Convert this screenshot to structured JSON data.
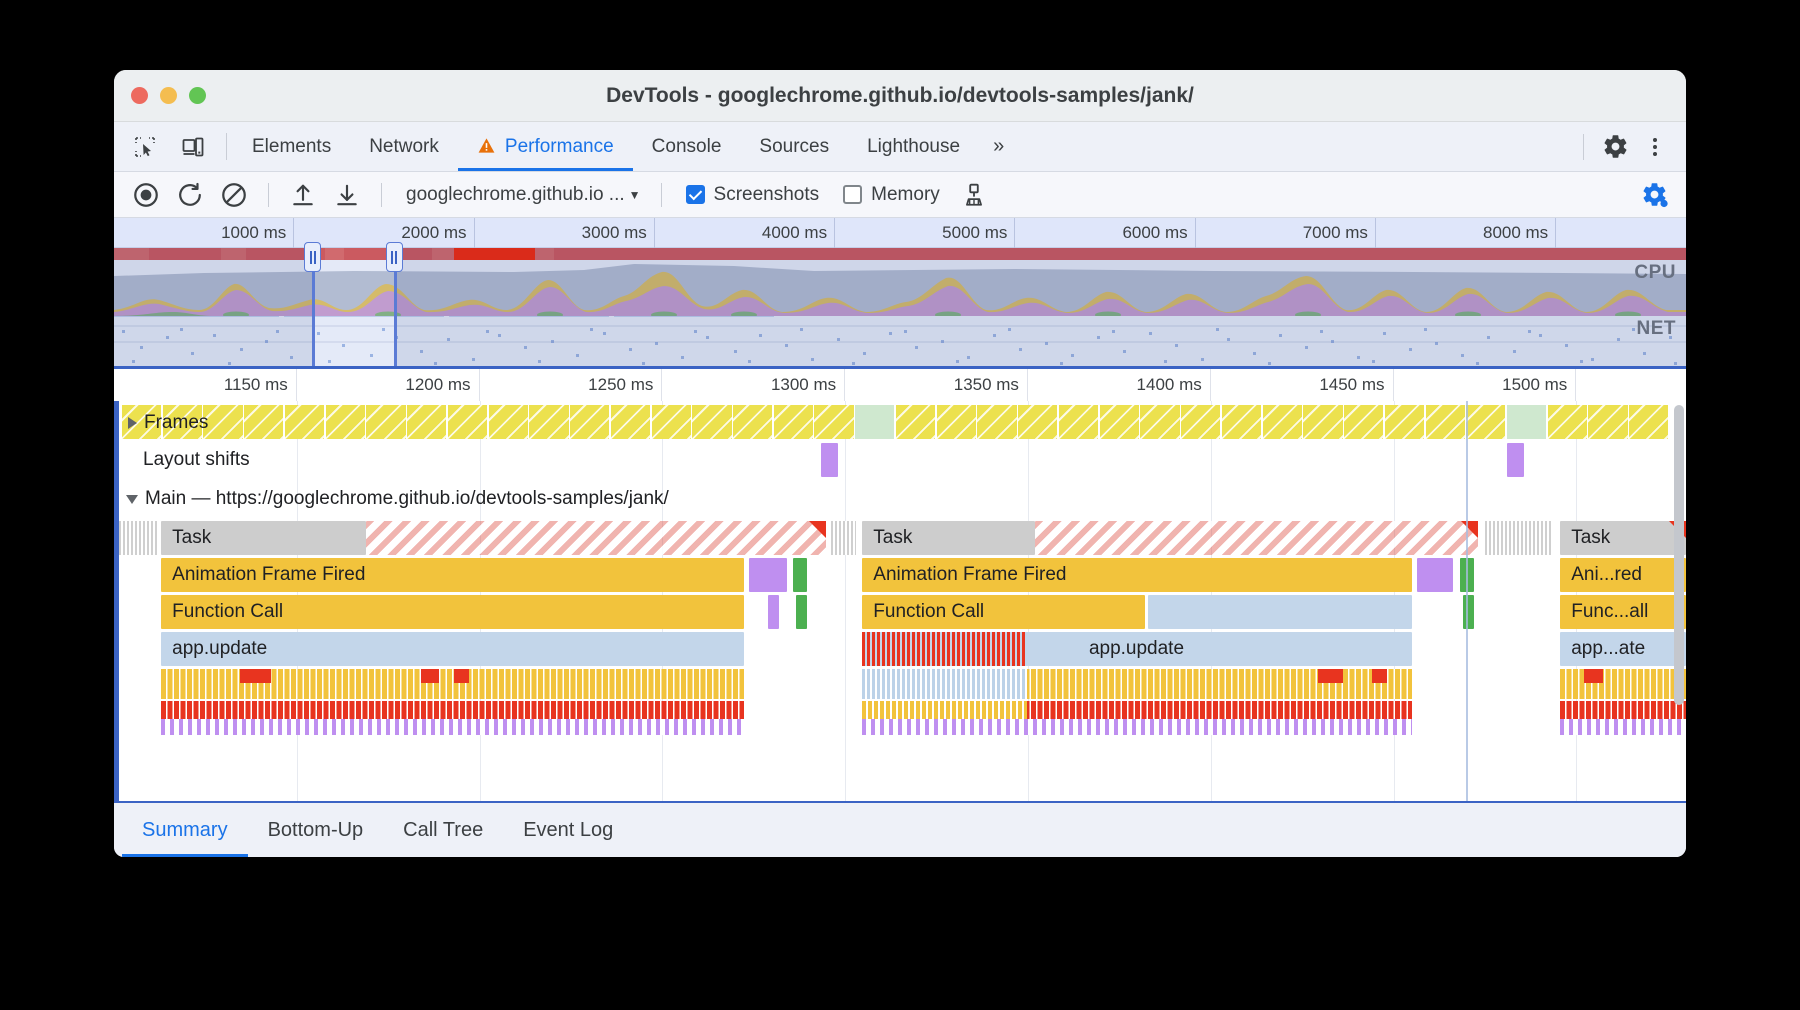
{
  "window": {
    "title": "DevTools - googlechrome.github.io/devtools-samples/jank/",
    "traffic": {
      "close": "close-button",
      "minimize": "minimize-button",
      "zoom": "zoom-button"
    }
  },
  "tabstrip": {
    "inspect_icon": "inspect-element-icon",
    "device_icon": "device-toolbar-icon",
    "tabs": [
      {
        "label": "Elements",
        "active": false,
        "warn": false
      },
      {
        "label": "Network",
        "active": false,
        "warn": false
      },
      {
        "label": "Performance",
        "active": true,
        "warn": true
      },
      {
        "label": "Console",
        "active": false,
        "warn": false
      },
      {
        "label": "Sources",
        "active": false,
        "warn": false
      },
      {
        "label": "Lighthouse",
        "active": false,
        "warn": false
      }
    ],
    "more_tabs": "»",
    "settings_icon": "gear-icon",
    "menu_icon": "kebab-menu-icon"
  },
  "controls": {
    "record": "record-button",
    "reload": "reload-and-record-button",
    "clear": "clear-recording-button",
    "load": "load-profile-button",
    "save": "save-profile-button",
    "target_label": "googlechrome.github.io ...",
    "target_caret": "▼",
    "screenshots_label": "Screenshots",
    "screenshots_checked": true,
    "memory_label": "Memory",
    "memory_checked": false,
    "gc_icon": "collect-garbage-icon",
    "capture_settings_icon": "capture-settings-gear-icon"
  },
  "overview": {
    "ticks": [
      "1000 ms",
      "2000 ms",
      "3000 ms",
      "4000 ms",
      "5000 ms",
      "6000 ms",
      "7000 ms",
      "8000 ms"
    ],
    "cpu_label": "CPU",
    "net_label": "NET",
    "selection_start_pct": 12.6,
    "selection_end_pct": 17.8,
    "handle_left_icon": "window-handle-left",
    "handle_right_icon": "window-handle-right"
  },
  "flame": {
    "ticks": [
      "1150 ms",
      "1200 ms",
      "1250 ms",
      "1300 ms",
      "1350 ms",
      "1400 ms",
      "1450 ms",
      "1500 ms"
    ],
    "tracks": {
      "frames": {
        "label": "Frames",
        "expander": "collapsed"
      },
      "layout_shifts": {
        "label": "Layout shifts"
      },
      "main": {
        "label": "Main — https://googlechrome.github.io/devtools-samples/jank/",
        "expander": "expanded"
      }
    },
    "groups": [
      {
        "name": "group-1",
        "left_pct": 2.0,
        "width_pct": 45.5,
        "task_label": "Task",
        "rows": [
          {
            "label": "Animation Frame Fired",
            "kind": "yellow"
          },
          {
            "label": "Function Call",
            "kind": "yellow"
          },
          {
            "label": "app.update",
            "kind": "blue"
          }
        ]
      },
      {
        "name": "group-2",
        "left_pct": 47.6,
        "width_pct": 39.5,
        "task_label": "Task",
        "rows": [
          {
            "label": "Animation Frame Fired",
            "kind": "yellow"
          },
          {
            "label": "Function Call",
            "kind": "yellow"
          },
          {
            "label": "app.update",
            "kind": "blue"
          }
        ]
      },
      {
        "name": "group-3",
        "left_pct": 92.0,
        "width_pct": 8.0,
        "task_label": "Task",
        "rows": [
          {
            "label": "Ani...red",
            "kind": "yellow"
          },
          {
            "label": "Func...all",
            "kind": "yellow"
          },
          {
            "label": "app...ate",
            "kind": "blue"
          }
        ]
      }
    ]
  },
  "bottom_tabs": [
    {
      "label": "Summary",
      "active": true
    },
    {
      "label": "Bottom-Up",
      "active": false
    },
    {
      "label": "Call Tree",
      "active": false
    },
    {
      "label": "Event Log",
      "active": false
    }
  ],
  "colors": {
    "accent": "#1a73e8",
    "warning": "#e8710a",
    "frame_yellow": "#ece14e",
    "task_gray": "#cdcdcd",
    "event_yellow": "#f2c33c",
    "update_blue": "#c3d6ea",
    "layout_purple": "#bf8ff0",
    "paint_green": "#4cb050",
    "long_task_red": "#e8341f"
  }
}
